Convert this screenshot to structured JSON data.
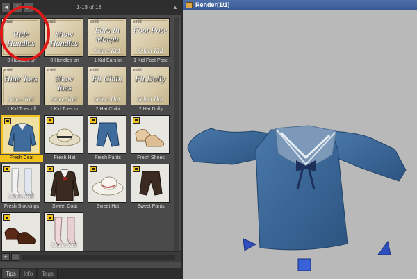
{
  "library": {
    "page_number": "1",
    "range_label": "1-18 of 18",
    "nav_prev_glyph": "◄",
    "nav_next_glyph": "►",
    "scroll_up_glyph": "▲",
    "add_glyph": "+",
    "remove_glyph": "–",
    "items": [
      {
        "title": "Hide Handles",
        "sub": "",
        "caption": "0 Handles off",
        "tag": "e3dd"
      },
      {
        "title": "Show Handles",
        "sub": "",
        "caption": "0 Handles on",
        "tag": "e3dd"
      },
      {
        "title": "Ears In Morph",
        "sub": "Select Kid",
        "caption": "1 Kid Ears in",
        "tag": "e3dd"
      },
      {
        "title": "Foot Pose",
        "sub": "Select Kid",
        "caption": "1 Kid Foot Pose",
        "tag": "e3dd"
      },
      {
        "title": "Hide Toes",
        "sub": "Select Kid",
        "caption": "1 Kid Toes off",
        "tag": "e3dd"
      },
      {
        "title": "Show Toes",
        "sub": "Select Kid",
        "caption": "1 Kid Toes on",
        "tag": "e3dd"
      },
      {
        "title": "Fit Chibi",
        "sub": "Select Hat",
        "caption": "2 Hat Chibi",
        "tag": "e3dd"
      },
      {
        "title": "Fit Dolly",
        "sub": "Select Hat",
        "caption": "2 Hat Dolly",
        "tag": "e3dd"
      },
      {
        "title": "",
        "sub": "",
        "caption": "Fresh Coat",
        "tag": ""
      },
      {
        "title": "",
        "sub": "",
        "caption": "Fresh Hat",
        "tag": ""
      },
      {
        "title": "",
        "sub": "",
        "caption": "Fresh Pants",
        "tag": ""
      },
      {
        "title": "",
        "sub": "",
        "caption": "Fresh Shoes",
        "tag": ""
      },
      {
        "title": "",
        "sub": "Select Kid",
        "caption": "Fresh Stockings",
        "tag": ""
      },
      {
        "title": "",
        "sub": "",
        "caption": "Sweet Coat",
        "tag": ""
      },
      {
        "title": "",
        "sub": "",
        "caption": "Sweet Hat",
        "tag": ""
      },
      {
        "title": "",
        "sub": "",
        "caption": "Sweet Pants",
        "tag": ""
      },
      {
        "title": "",
        "sub": "",
        "caption": "",
        "tag": ""
      },
      {
        "title": "",
        "sub": "Select Kid",
        "caption": "",
        "tag": ""
      }
    ],
    "tabs": [
      "Tips",
      "Info",
      "Tags"
    ]
  },
  "render": {
    "title": "Render(1/1)"
  },
  "colors": {
    "selection": "#f2c21a",
    "shirt_blue": "#3f6c9c",
    "title_bar": "#3f5f9a"
  }
}
